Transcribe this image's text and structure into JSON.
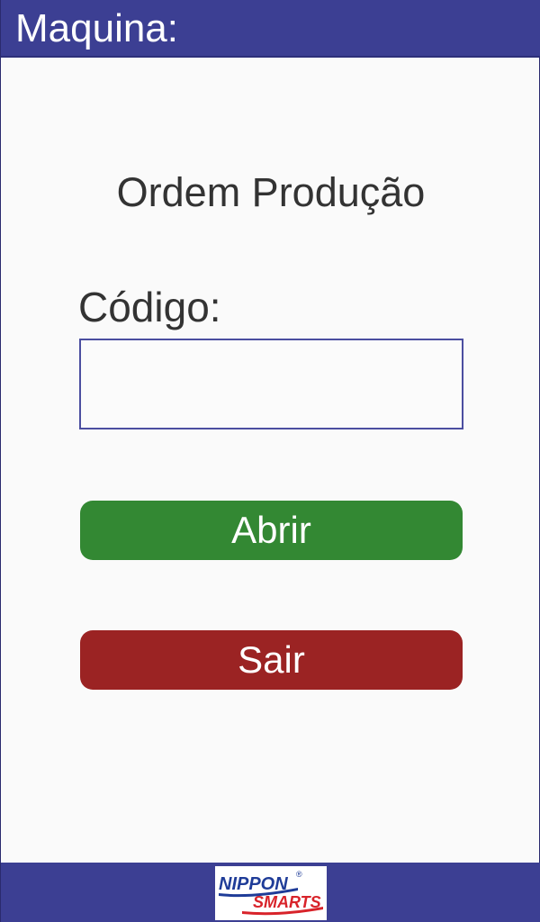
{
  "header": {
    "title": "Maquina:"
  },
  "main": {
    "page_title": "Ordem Produção",
    "code_label": "Código:",
    "code_value": "",
    "open_label": "Abrir",
    "exit_label": "Sair"
  },
  "footer": {
    "logo_top": "NIPPON",
    "logo_mark": "®",
    "logo_bottom": "SMARTS"
  },
  "colors": {
    "header_bar": "#3c3f93",
    "open_button": "#338833",
    "exit_button": "#9b2323",
    "logo_blue": "#1f3c98",
    "logo_red": "#d8232a"
  }
}
